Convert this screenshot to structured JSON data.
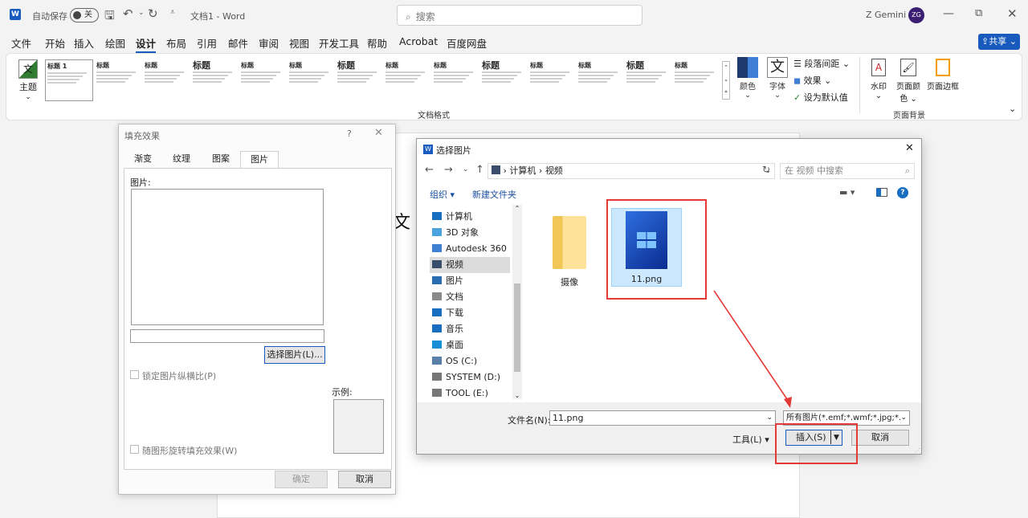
{
  "titlebar": {
    "autosave_label": "自动保存",
    "autosave_state": "关",
    "doc_title": "文档1 - Word",
    "search_placeholder": "搜索",
    "user_name": "Z Gemini",
    "user_initials": "ZG"
  },
  "menu": {
    "items": [
      "文件",
      "开始",
      "插入",
      "绘图",
      "设计",
      "布局",
      "引用",
      "邮件",
      "审阅",
      "视图",
      "开发工具",
      "帮助",
      "Acrobat",
      "百度网盘"
    ],
    "active": "设计",
    "share_label": "共享"
  },
  "ribbon": {
    "theme_label": "主题",
    "style_thumb_heading": "标题",
    "style_thumb_heading1": "标题 1",
    "group_doc_format": "文档格式",
    "colors_label": "颜色",
    "fonts_label": "字体",
    "font_glyph": "文",
    "paragraph_spacing": "段落间距",
    "effects": "效果",
    "set_default": "设为默认值",
    "watermark": "水印",
    "page_color_1": "页面颜",
    "page_color_2": "色",
    "page_border": "页面边框",
    "group_page_bg": "页面背景"
  },
  "doc": {
    "partial_text": "文"
  },
  "fill_dialog": {
    "title": "填充效果",
    "help": "?",
    "tabs": [
      "渐变",
      "纹理",
      "图案",
      "图片"
    ],
    "selected_tab": "图片",
    "picture_label": "图片:",
    "select_picture_button": "选择图片(L)...",
    "lock_aspect": "锁定图片纵横比(P)",
    "sample_label": "示例:",
    "rotate_with_shape": "随图形旋转填充效果(W)",
    "ok": "确定",
    "cancel": "取消"
  },
  "file_dialog": {
    "title": "选择图片",
    "breadcrumb": [
      "计算机",
      "视频"
    ],
    "search_placeholder": "在 视频 中搜索",
    "organize": "组织",
    "new_folder": "新建文件夹",
    "nav_items": [
      "计算机",
      "3D 对象",
      "Autodesk 360",
      "视频",
      "图片",
      "文档",
      "下载",
      "音乐",
      "桌面",
      "OS (C:)",
      "SYSTEM (D:)",
      "TOOL (E:)"
    ],
    "selected_nav": "视频",
    "files": [
      {
        "name": "摄像",
        "type": "folder"
      },
      {
        "name": "11.png",
        "type": "image"
      }
    ],
    "filename_label": "文件名(N):",
    "filename_value": "11.png",
    "filter_value": "所有图片(*.emf;*.wmf;*.jpg;*.j",
    "tools": "工具(L)",
    "insert": "插入(S)",
    "cancel": "取消"
  },
  "colors": {
    "accent": "#185abd",
    "highlight": "#e53935",
    "selection": "#cce8ff"
  }
}
